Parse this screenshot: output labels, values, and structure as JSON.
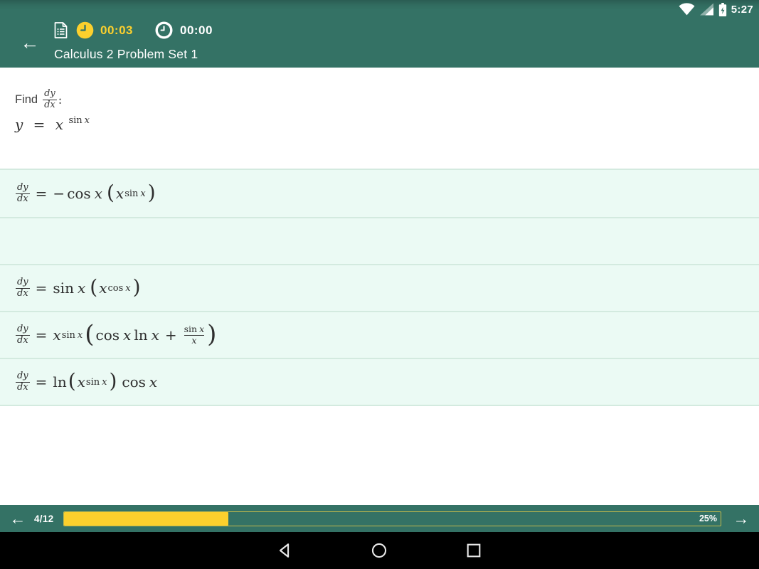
{
  "status_bar": {
    "time": "5:27"
  },
  "app_bar": {
    "back_arrow": "←",
    "title": "Calculus 2 Problem Set 1",
    "quiz_timer": "00:03",
    "question_timer": "00:00"
  },
  "question": {
    "label": "Find",
    "frac_num": "dy",
    "frac_den": "dx",
    "colon": ":",
    "lhs": "y",
    "eq": "=",
    "base": "x",
    "sup_fn": "sin",
    "sup_var": "x"
  },
  "answers": [
    {
      "num": "dy",
      "den": "dx",
      "eq": "=",
      "minus": "−",
      "fn1": "cos",
      "var1": "x",
      "open": "(",
      "base": "x",
      "sup_fn": "sin",
      "sup_var": "x",
      "close": ")"
    },
    {},
    {
      "num": "dy",
      "den": "dx",
      "eq": "=",
      "fn1": "sin",
      "var1": "x",
      "open": "(",
      "base": "x",
      "sup_fn": "cos",
      "sup_var": "x",
      "close": ")"
    },
    {
      "num": "dy",
      "den": "dx",
      "eq": "=",
      "base": "x",
      "sup_fn": "sin",
      "sup_var": "x",
      "open": "(",
      "fn1": "cos",
      "var1": "x",
      "fn2": "ln",
      "var2": "x",
      "plus": "+",
      "frac_num_fn": "sin",
      "frac_num_var": "x",
      "frac_den": "x",
      "close": ")"
    },
    {
      "num": "dy",
      "den": "dx",
      "eq": "=",
      "fn1": "ln",
      "open": "(",
      "base": "x",
      "sup_fn": "sin",
      "sup_var": "x",
      "close": ")",
      "fn2": "cos",
      "var2": "x"
    }
  ],
  "footer": {
    "back_arrow": "←",
    "counter": "4/12",
    "progress_pct": 25,
    "progress_label": "25%",
    "next_arrow": "→"
  },
  "colors": {
    "primary_teal": "#347265",
    "accent_yellow": "#fcd02d",
    "answer_mint": "#ebfaf4",
    "separator_mint": "#d3eadf"
  }
}
